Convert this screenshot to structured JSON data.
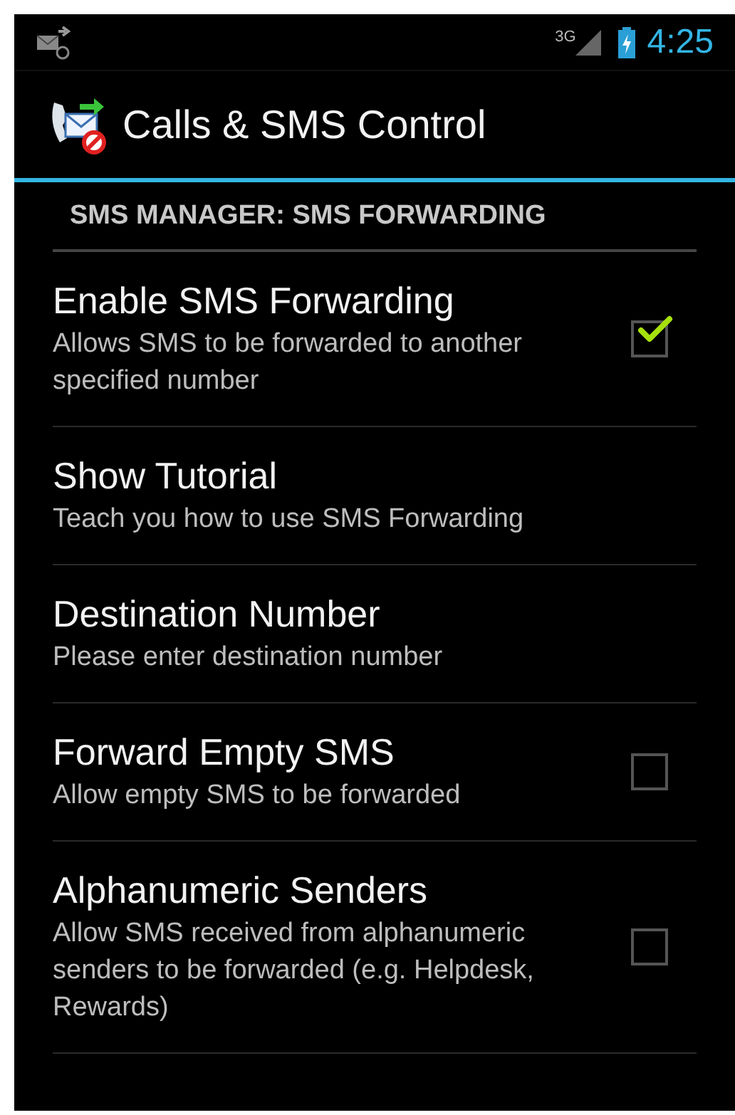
{
  "status_bar": {
    "signal_label": "3G",
    "time": "4:25"
  },
  "action_bar": {
    "title": "Calls & SMS Control"
  },
  "section": {
    "title": "SMS MANAGER: SMS FORWARDING"
  },
  "items": [
    {
      "kind": "checkbox",
      "title": "Enable SMS Forwarding",
      "summary": "Allows SMS to be forwarded to another specified number",
      "checked": true
    },
    {
      "kind": "plain",
      "title": "Show Tutorial",
      "summary": "Teach you how to use SMS Forwarding"
    },
    {
      "kind": "plain",
      "title": "Destination Number",
      "summary": "Please enter destination number"
    },
    {
      "kind": "checkbox",
      "title": "Forward Empty SMS",
      "summary": "Allow empty SMS to be forwarded",
      "checked": false
    },
    {
      "kind": "checkbox",
      "title": "Alphanumeric Senders",
      "summary": "Allow SMS received from alphanumeric senders to be forwarded (e.g. Helpdesk, Rewards)",
      "checked": false
    }
  ]
}
